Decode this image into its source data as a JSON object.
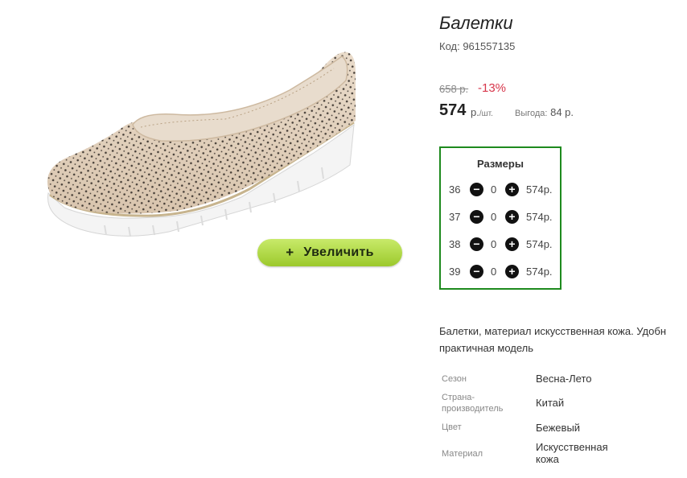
{
  "product": {
    "title": "Балетки",
    "code": "Код: 961557135",
    "old_price": "658 р.",
    "discount": "-13%",
    "price": "574",
    "price_unit": "р.",
    "price_per": "/шт.",
    "savings_label": "Выгода:",
    "savings_value": "84 р.",
    "image_alt": "beige-perforated-ballet-flat"
  },
  "zoom_button": {
    "label": "Увеличить",
    "icon": "plus-icon"
  },
  "sizes": {
    "title": "Размеры",
    "rows": [
      {
        "size": "36",
        "qty": "0",
        "price": "574р."
      },
      {
        "size": "37",
        "qty": "0",
        "price": "574р."
      },
      {
        "size": "38",
        "qty": "0",
        "price": "574р."
      },
      {
        "size": "39",
        "qty": "0",
        "price": "574р."
      }
    ],
    "border_color": "#1e8a1e"
  },
  "description": {
    "line1": "Балетки, материал искусственная кожа. Удобн",
    "line2": "практичная модель"
  },
  "specs": [
    {
      "label": "Сезон",
      "value": "Весна-Лето"
    },
    {
      "label_line1": "Страна-",
      "label_line2": "производитель",
      "value": "Китай"
    },
    {
      "label": "Цвет",
      "value": "Бежевый"
    },
    {
      "label": "Материал",
      "value_line1": "Искусственная",
      "value_line2": "кожа"
    }
  ],
  "colors": {
    "discount": "#d7364b",
    "zoom_button": "#9cc92c"
  }
}
